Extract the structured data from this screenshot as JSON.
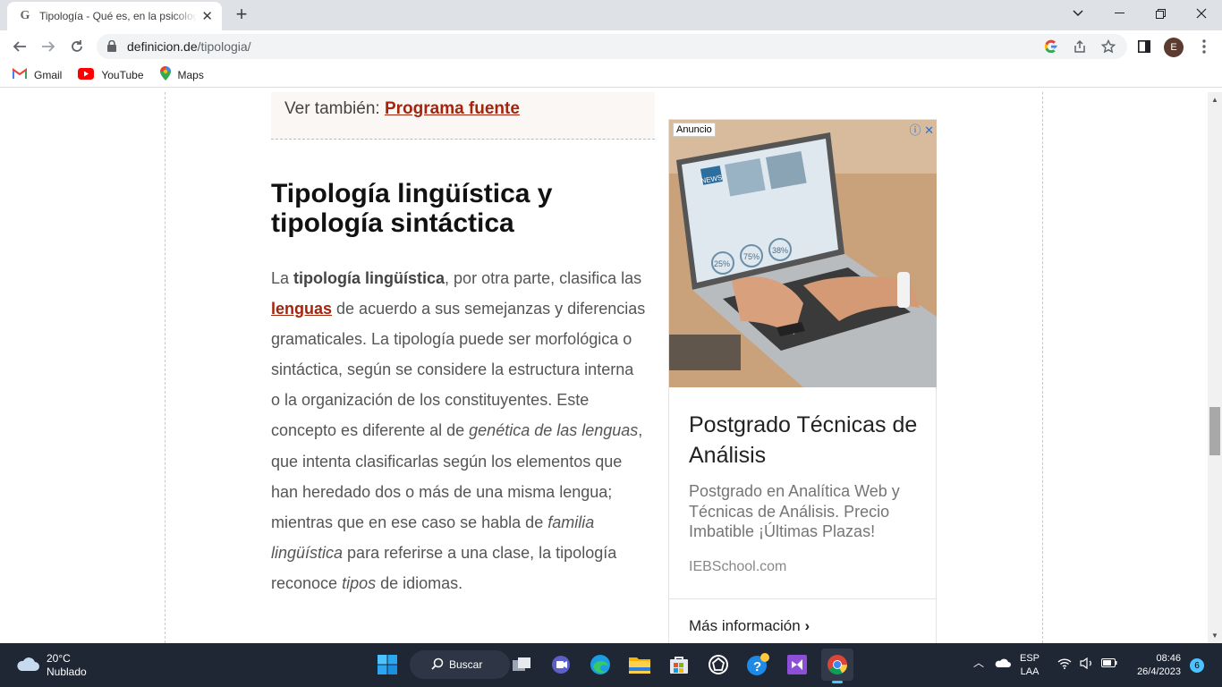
{
  "browser": {
    "tab_title": "Tipología - Qué es, en la psicología, lingüística",
    "tab_favicon_letter": "G",
    "url_domain": "definicion.de",
    "url_path": "/tipologia/",
    "profile_initial": "E"
  },
  "bookmarks": [
    {
      "label": "Gmail",
      "icon": "gmail-icon"
    },
    {
      "label": "YouTube",
      "icon": "youtube-icon"
    },
    {
      "label": "Maps",
      "icon": "maps-icon"
    }
  ],
  "article": {
    "see_also_prefix": "Ver también: ",
    "see_also_link": "Programa fuente",
    "heading": "Tipología lingüística y tipología sintáctica",
    "p1": "La ",
    "p2": "tipología lingüística",
    "p3": ", por otra parte, clasifica las ",
    "p4": "lenguas",
    "p5": " de acuerdo a sus semejanzas y diferencias gramaticales. La tipología puede ser morfológica o sintáctica, según se considere la estructura interna o la organización de los constituyentes. Este concepto es diferente al de ",
    "p6": "genética de las lenguas",
    "p7": ", que intenta clasificarlas según los elementos que han heredado dos o más de una misma lengua; mientras que en ese caso se habla de ",
    "p8": "familia lingüística",
    "p9": " para referirse a una clase, la tipología reconoce ",
    "p10": "tipos",
    "p11": " de idiomas."
  },
  "ad": {
    "label": "Anuncio",
    "title": "Postgrado Técnicas de Análisis",
    "description": "Postgrado en Analítica Web y Técnicas de Análisis. Precio Imbatible ¡Últimas Plazas!",
    "source": "IEBSchool.com",
    "cta": "Más información",
    "image_text": {
      "logo": "NEWS",
      "stat1": "25%",
      "stat2": "75%",
      "stat3": "38%"
    }
  },
  "taskbar": {
    "temp": "20°C",
    "condition": "Nublado",
    "search_label": "Buscar",
    "lang1": "ESP",
    "lang2": "LAA",
    "time": "08:46",
    "date": "26/4/2023",
    "notifications": "6"
  }
}
